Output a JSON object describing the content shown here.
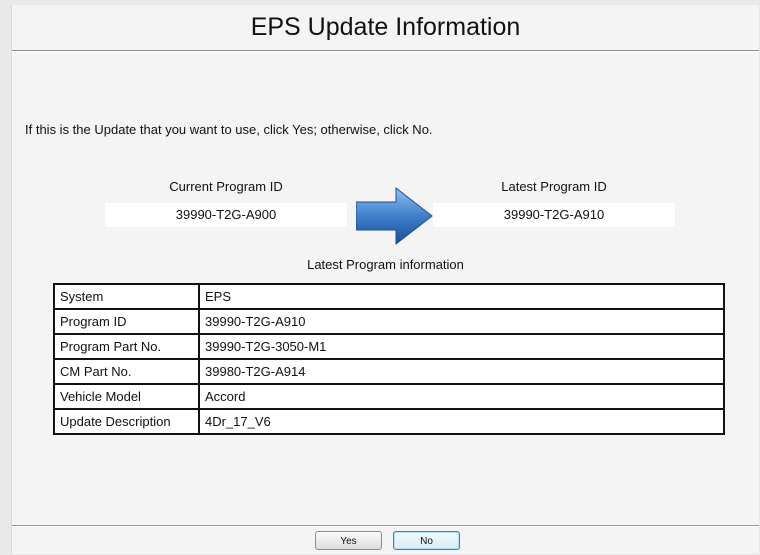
{
  "window": {
    "title": "EPS Update Information"
  },
  "instruction": "If this is the Update that you want to use, click Yes; otherwise, click No.",
  "current": {
    "label": "Current Program ID",
    "value": "39990-T2G-A900"
  },
  "latest": {
    "label": "Latest Program ID",
    "value": "39990-T2G-A910"
  },
  "arrow_icon": "arrow-right-icon",
  "info": {
    "title": "Latest Program information",
    "rows": [
      {
        "key": "System",
        "value": "EPS"
      },
      {
        "key": "Program ID",
        "value": "39990-T2G-A910"
      },
      {
        "key": "Program Part No.",
        "value": "39990-T2G-3050-M1"
      },
      {
        "key": "CM Part No.",
        "value": "39980-T2G-A914"
      },
      {
        "key": "Vehicle Model",
        "value": "Accord"
      },
      {
        "key": "Update Description",
        "value": "4Dr_17_V6"
      }
    ]
  },
  "buttons": {
    "yes": "Yes",
    "no": "No"
  },
  "colors": {
    "arrow_light": "#7fb2e6",
    "arrow_dark": "#1f5aa8",
    "background": "#f4f4f4"
  }
}
